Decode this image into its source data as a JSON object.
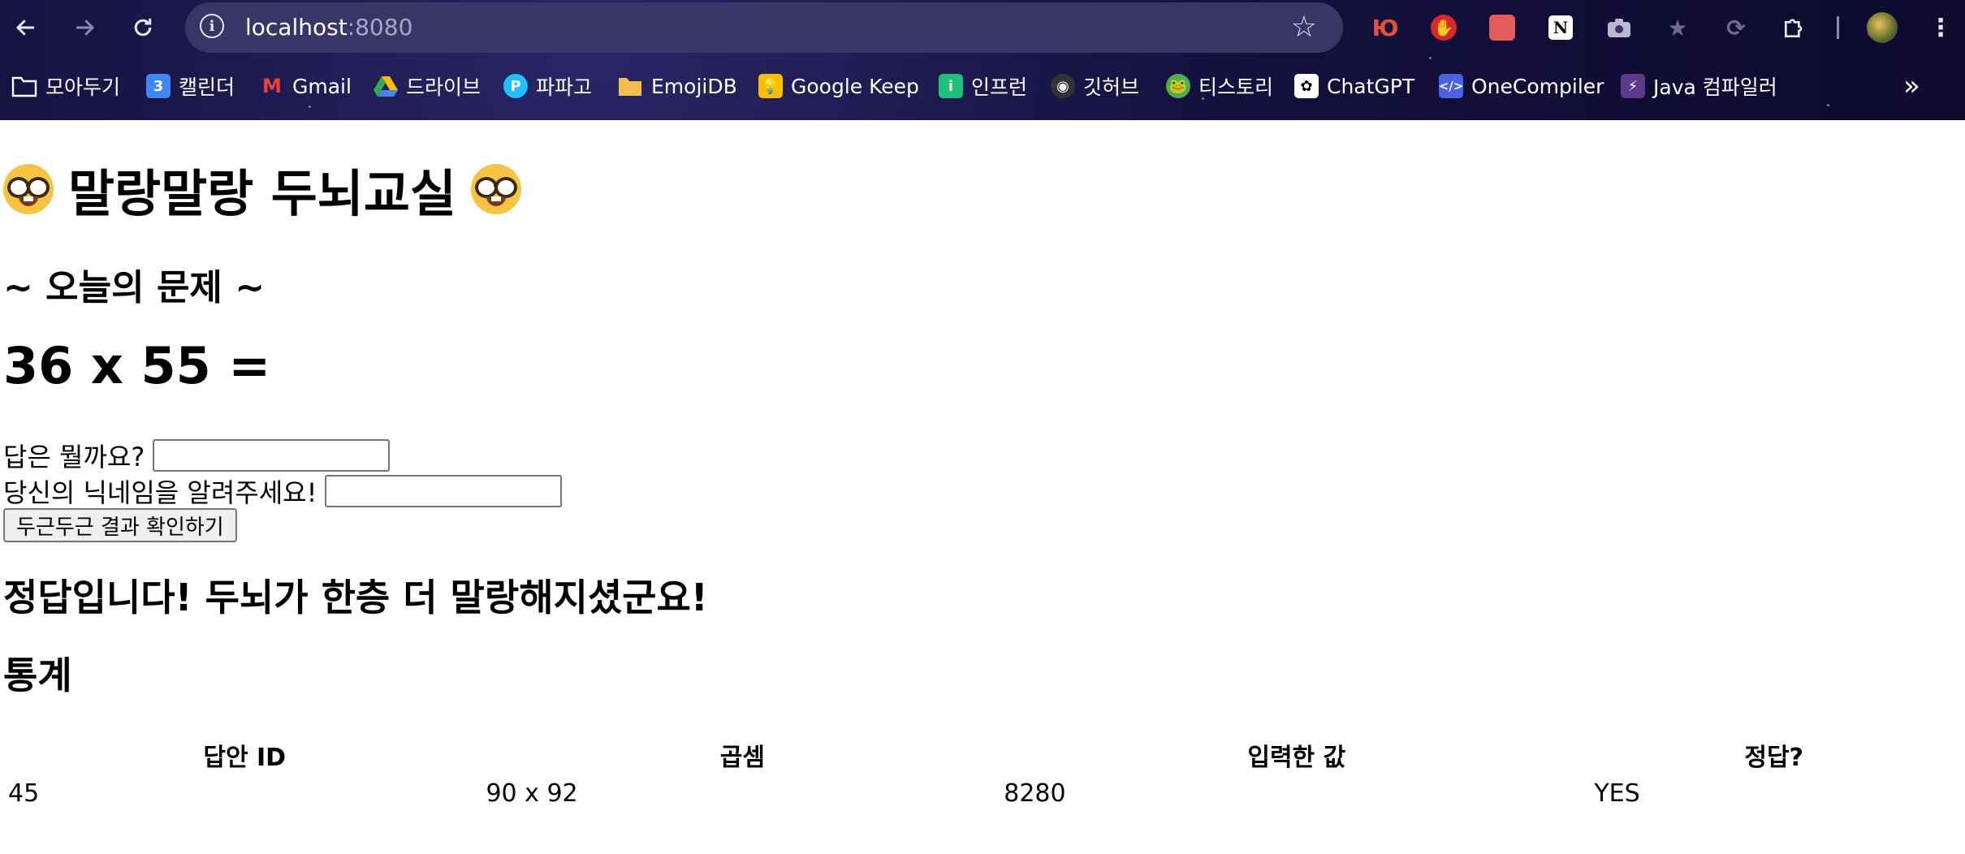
{
  "browser": {
    "url_host": "localhost",
    "url_port": ":8080",
    "bookmarks": [
      {
        "label": "모아두기",
        "icon": "folder-icon",
        "color": "transparent"
      },
      {
        "label": "캘린더",
        "icon": "calendar-icon",
        "color": "#4285f4"
      },
      {
        "label": "Gmail",
        "icon": "gmail-icon",
        "color": "transparent"
      },
      {
        "label": "드라이브",
        "icon": "drive-icon",
        "color": "transparent"
      },
      {
        "label": "파파고",
        "icon": "papago-icon",
        "color": "#1fc0ff"
      },
      {
        "label": "EmojiDB",
        "icon": "folder-icon",
        "color": "transparent"
      },
      {
        "label": "Google Keep",
        "icon": "keep-icon",
        "color": "#fbbc04"
      },
      {
        "label": "인프런",
        "icon": "inflearn-icon",
        "color": "#1dc078"
      },
      {
        "label": "깃허브",
        "icon": "github-icon",
        "color": "#333333"
      },
      {
        "label": "티스토리",
        "icon": "tistory-icon",
        "color": "transparent"
      },
      {
        "label": "ChatGPT",
        "icon": "chatgpt-icon",
        "color": "#ffffff"
      },
      {
        "label": "OneCompiler",
        "icon": "onecompiler-icon",
        "color": "#4a63e6"
      },
      {
        "label": "Java 컴파일러",
        "icon": "bolt-icon",
        "color": "#5b3a8a"
      }
    ]
  },
  "page": {
    "title": "말랑말랑 두뇌교실",
    "subtitle": "~ 오늘의 문제 ~",
    "problem": "36 x 55 =",
    "answer_label": "답은 뭘까요?",
    "nickname_label": "당신의 닉네임을 알려주세요!",
    "submit_label": "두근두근 결과 확인하기",
    "result_message": "정답입니다! 두뇌가 한층 더 말랑해지셨군요!",
    "stats_title": "통계",
    "table": {
      "headers": [
        "답안 ID",
        "곱셈",
        "입력한 값",
        "정답?"
      ],
      "rows": [
        [
          "45",
          "90 x 92",
          "8280",
          "YES"
        ]
      ]
    }
  }
}
